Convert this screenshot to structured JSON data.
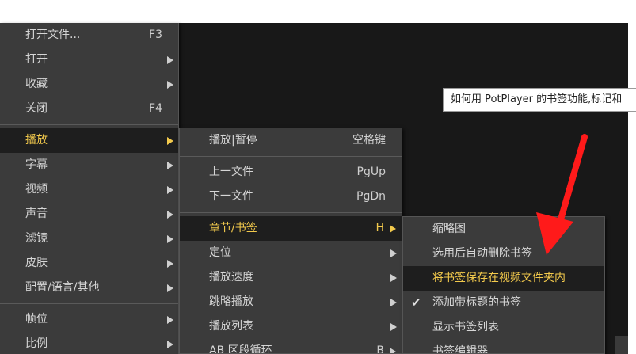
{
  "tooltip": {
    "text": "如何用 PotPlayer 的书签功能,标记和"
  },
  "main_menu": {
    "items": [
      {
        "label": "打开文件...",
        "shortcut": "F3"
      },
      {
        "label": "打开"
      },
      {
        "label": "收藏"
      },
      {
        "label": "关闭",
        "shortcut": "F4"
      },
      {
        "label": "播放"
      },
      {
        "label": "字幕"
      },
      {
        "label": "视频"
      },
      {
        "label": "声音"
      },
      {
        "label": "滤镜"
      },
      {
        "label": "皮肤"
      },
      {
        "label": "配置/语言/其他"
      },
      {
        "label": "帧位"
      },
      {
        "label": "比例"
      }
    ]
  },
  "play_menu": {
    "items": [
      {
        "label": "播放|暂停",
        "shortcut": "空格键"
      },
      {
        "label": "上一文件",
        "shortcut": "PgUp"
      },
      {
        "label": "下一文件",
        "shortcut": "PgDn"
      },
      {
        "label": "章节/书签",
        "shortcut": "H"
      },
      {
        "label": "定位"
      },
      {
        "label": "播放速度"
      },
      {
        "label": "跳略播放"
      },
      {
        "label": "播放列表"
      },
      {
        "label": "AB 区段循环",
        "shortcut": "B"
      }
    ]
  },
  "bookmark_menu": {
    "items": [
      {
        "label": "缩略图"
      },
      {
        "label": "选用后自动删除书签"
      },
      {
        "label": "将书签保存在视频文件夹内"
      },
      {
        "label": "添加带标题的书签",
        "checked": true
      },
      {
        "label": "显示书签列表"
      },
      {
        "label": "书签编辑器"
      }
    ]
  },
  "colors": {
    "menu_bg": "#3b3b3b",
    "highlight_bg": "#1e1e1e",
    "highlight_text": "#f2c94c",
    "annotation_arrow": "#ff1a1a"
  }
}
